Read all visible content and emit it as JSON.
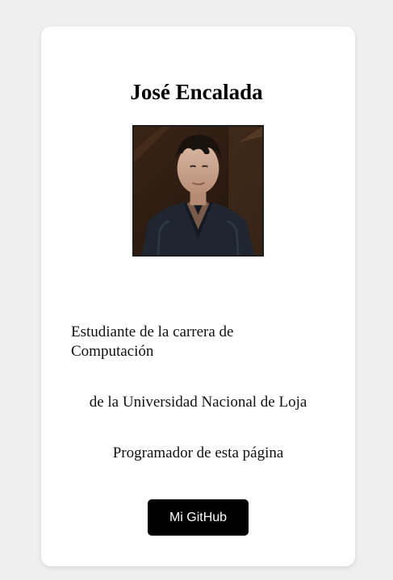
{
  "profile": {
    "name": "José Encalada",
    "photo_icon": "profile-photo"
  },
  "description": {
    "line1": "Estudiante de la carrera de Computación",
    "line2": "de la Universidad Nacional de Loja",
    "line3": "Programador de esta página"
  },
  "actions": {
    "github_label": "Mi GitHub"
  },
  "colors": {
    "page_background": "#efefef",
    "card_background": "#ffffff",
    "button_background": "#000000",
    "button_text": "#ffffff"
  }
}
